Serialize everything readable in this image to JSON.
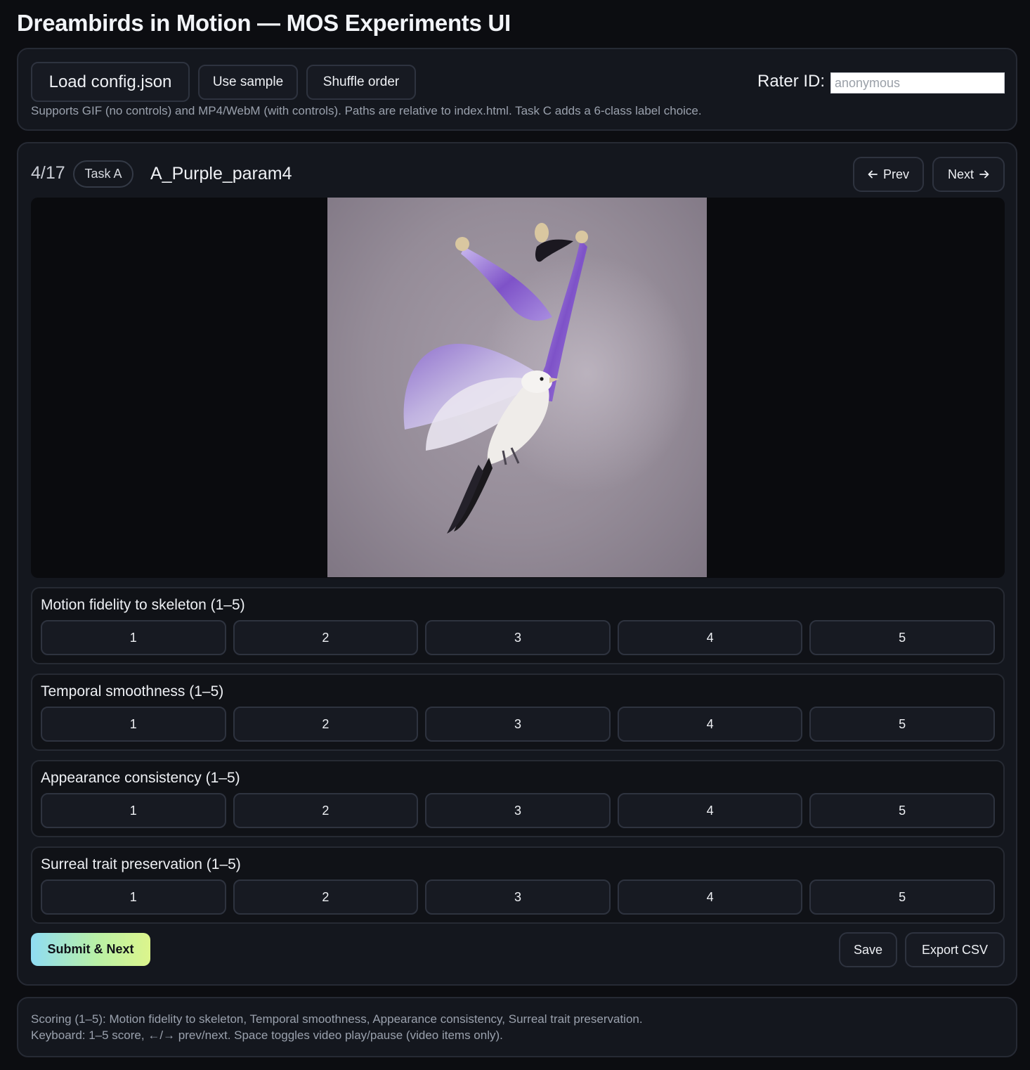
{
  "app_title": "Dreambirds in Motion — MOS Experiments UI",
  "toolbar": {
    "load_label": "Load config.json",
    "sample_label": "Use sample",
    "shuffle_label": "Shuffle order",
    "rater_label": "Rater ID:",
    "rater_placeholder": "anonymous",
    "rater_value": "",
    "hint": "Supports GIF (no controls) and MP4/WebM (with controls). Paths are relative to index.html. Task C adds a 6-class label choice."
  },
  "item": {
    "counter": "4/17",
    "task": "Task A",
    "name": "A_Purple_param4",
    "prev_label": "Prev",
    "next_label": "Next",
    "prev_icon": "arrow-left-icon",
    "next_icon": "arrow-right-icon"
  },
  "media": {
    "icon": "bird-image"
  },
  "ratings": [
    {
      "label": "Motion fidelity to skeleton (1–5)",
      "options": [
        "1",
        "2",
        "3",
        "4",
        "5"
      ]
    },
    {
      "label": "Temporal smoothness (1–5)",
      "options": [
        "1",
        "2",
        "3",
        "4",
        "5"
      ]
    },
    {
      "label": "Appearance consistency (1–5)",
      "options": [
        "1",
        "2",
        "3",
        "4",
        "5"
      ]
    },
    {
      "label": "Surreal trait preservation (1–5)",
      "options": [
        "1",
        "2",
        "3",
        "4",
        "5"
      ]
    }
  ],
  "actions": {
    "submit_label": "Submit & Next",
    "save_label": "Save",
    "export_label": "Export CSV"
  },
  "footer": {
    "line1": "Scoring (1–5): Motion fidelity to skeleton, Temporal smoothness, Appearance consistency, Surreal trait preservation.",
    "line2": "Keyboard: 1–5 score, ←/→ prev/next. Space toggles video play/pause (video items only)."
  },
  "colors": {
    "background": "#0c0d11",
    "panel": "#14171e",
    "accent_start": "#8fdcf3",
    "accent_end": "#dcf58c",
    "media_bg": "#958c98",
    "bird_purple": "#8f6fd0"
  }
}
